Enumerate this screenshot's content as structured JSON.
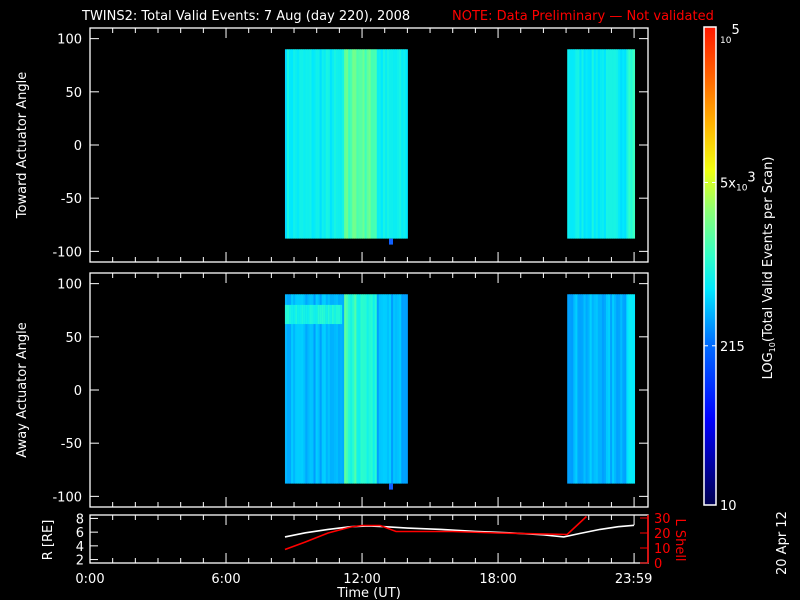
{
  "title": {
    "main": "TWINS2: Total Valid Events:  7 Aug (day 220), 2008",
    "note": "NOTE: Data Preliminary — Not validated",
    "note_color": "#ff0000"
  },
  "date_stamp": "20 Apr 12",
  "chart_data": [
    {
      "type": "heatmap",
      "name": "toward",
      "ylabel": "Toward Actuator Angle",
      "ylim": [
        -110,
        110
      ],
      "yticks": [
        "100",
        "50",
        "0",
        "-50",
        "-100"
      ],
      "ytick_values": [
        100,
        50,
        0,
        -50,
        -100
      ],
      "xlim_hours": [
        0,
        24
      ],
      "angle_range": [
        -88,
        90
      ],
      "data_intervals_hours": [
        [
          8.6,
          13.95
        ],
        [
          21.05,
          24.0
        ]
      ],
      "typical_level": "~300-1000 events/scan",
      "peak_interval_hours": [
        11.2,
        12.6
      ]
    },
    {
      "type": "heatmap",
      "name": "away",
      "ylabel": "Away Actuator Angle",
      "ylim": [
        -110,
        110
      ],
      "yticks": [
        "100",
        "50",
        "0",
        "-50",
        "-100"
      ],
      "ytick_values": [
        100,
        50,
        0,
        -50,
        -100
      ],
      "xlim_hours": [
        0,
        24
      ],
      "angle_range": [
        -88,
        90
      ],
      "data_intervals_hours": [
        [
          8.6,
          13.95
        ],
        [
          21.05,
          24.0
        ]
      ],
      "typical_level": "~150-500 events/scan",
      "peak_interval_hours": [
        11.2,
        12.6
      ]
    },
    {
      "type": "line",
      "name": "orbit",
      "ylabel": "R [RE]",
      "y2label": "L Shell",
      "ylim": [
        1.5,
        8.5
      ],
      "y2lim": [
        0,
        32
      ],
      "yticks": [
        "8",
        "6",
        "4",
        "2"
      ],
      "ytick_values": [
        8,
        6,
        4,
        2
      ],
      "y2ticks": [
        "30",
        "20",
        "10",
        "0"
      ],
      "y2tick_values": [
        30,
        20,
        10,
        0
      ],
      "xlabel": "Time (UT)",
      "xticks": [
        "0:00",
        "6:00",
        "12:00",
        "18:00",
        "23:59"
      ],
      "xtick_hours": [
        0,
        6,
        12,
        18,
        23.98
      ],
      "series": [
        {
          "name": "R",
          "color": "#ffffff",
          "x": [
            8.6,
            9.5,
            10.5,
            11.5,
            12.3,
            13.0,
            14.0,
            15.5,
            17.0,
            18.5,
            20.0,
            20.9,
            21.6,
            22.5,
            23.3,
            24.0
          ],
          "values": [
            5.3,
            5.9,
            6.4,
            6.8,
            6.9,
            6.8,
            6.6,
            6.4,
            6.1,
            5.9,
            5.6,
            5.3,
            5.8,
            6.4,
            6.8,
            7.0
          ]
        },
        {
          "name": "L Shell",
          "color": "#ff0000",
          "x": [
            8.6,
            9.5,
            10.5,
            11.5,
            12.0,
            12.8,
            13.5,
            16.0,
            18.0,
            21.05,
            21.9
          ],
          "values": [
            9,
            14,
            20,
            24,
            25,
            25,
            21,
            21,
            20,
            19,
            31
          ]
        }
      ]
    },
    {
      "type": "colorbar",
      "label": "LOG10(Total Valid Events per Scan)",
      "label_main": "LOG",
      "label_sub": "10",
      "label_rest": "(Total Valid  Events  per Scan)",
      "ticks": [
        "10",
        "215",
        "5x10^3",
        "10^5"
      ],
      "tick_values": [
        10,
        215,
        5000,
        100000
      ],
      "range": [
        10,
        100000
      ]
    }
  ]
}
